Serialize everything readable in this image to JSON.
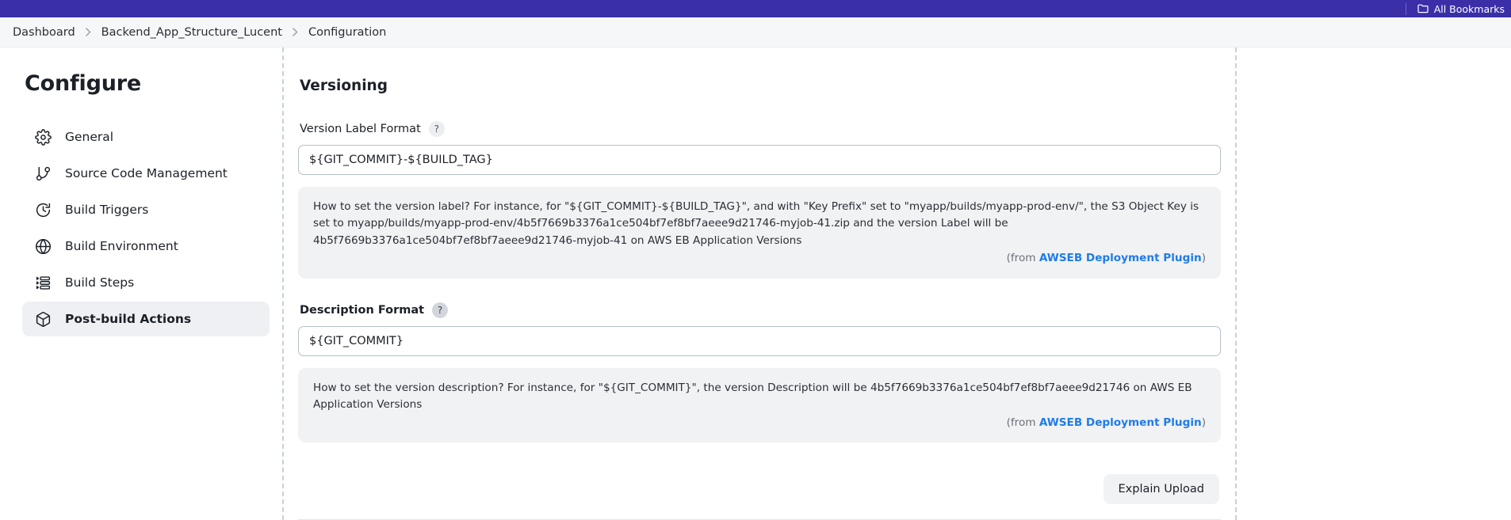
{
  "browser": {
    "bookmarks_label": "All Bookmarks",
    "folder_icon": "folder-icon",
    "bar_color": "#3b2fa8"
  },
  "breadcrumb": {
    "items": [
      {
        "label": "Dashboard"
      },
      {
        "label": "Backend_App_Structure_Lucent"
      },
      {
        "label": "Configuration"
      }
    ],
    "separator": "›"
  },
  "sidebar": {
    "title": "Configure",
    "items": [
      {
        "label": "General",
        "icon": "gear-icon",
        "active": false
      },
      {
        "label": "Source Code Management",
        "icon": "git-branch-icon",
        "active": false
      },
      {
        "label": "Build Triggers",
        "icon": "clock-icon",
        "active": false
      },
      {
        "label": "Build Environment",
        "icon": "globe-icon",
        "active": false
      },
      {
        "label": "Build Steps",
        "icon": "list-icon",
        "active": false
      },
      {
        "label": "Post-build Actions",
        "icon": "package-icon",
        "active": true
      }
    ]
  },
  "main": {
    "section_title": "Versioning",
    "version_label_field": {
      "label": "Version Label Format",
      "help_icon": "?",
      "value": "${GIT_COMMIT}-${BUILD_TAG}",
      "placeholder": "",
      "help_text": "How to set the version label? For instance, for \"${GIT_COMMIT}-${BUILD_TAG}\", and with \"Key Prefix\" set to \"myapp/builds/myapp-prod-env/\", the S3 Object Key is set to myapp/builds/myapp-prod-env/4b5f7669b3376a1ce504bf7ef8bf7aeee9d21746-myjob-41.zip and the version Label will be 4b5f7669b3376a1ce504bf7ef8bf7aeee9d21746-myjob-41 on AWS EB Application Versions",
      "from_prefix": "(from ",
      "from_link": "AWSEB Deployment Plugin",
      "from_suffix": ")"
    },
    "description_field": {
      "label": "Description Format",
      "help_icon": "?",
      "value": "${GIT_COMMIT}",
      "placeholder": "",
      "help_text": "How to set the version description? For instance, for \"${GIT_COMMIT}\", the version Description will be 4b5f7669b3376a1ce504bf7ef8bf7aeee9d21746 on AWS EB Application Versions",
      "from_prefix": "(from ",
      "from_link": "AWSEB Deployment Plugin",
      "from_suffix": ")"
    },
    "explain_upload_button": "Explain Upload"
  },
  "colors": {
    "link": "#1f7ce8",
    "accent": "#3b2fa8",
    "help_bg": "#f1f2f4"
  }
}
